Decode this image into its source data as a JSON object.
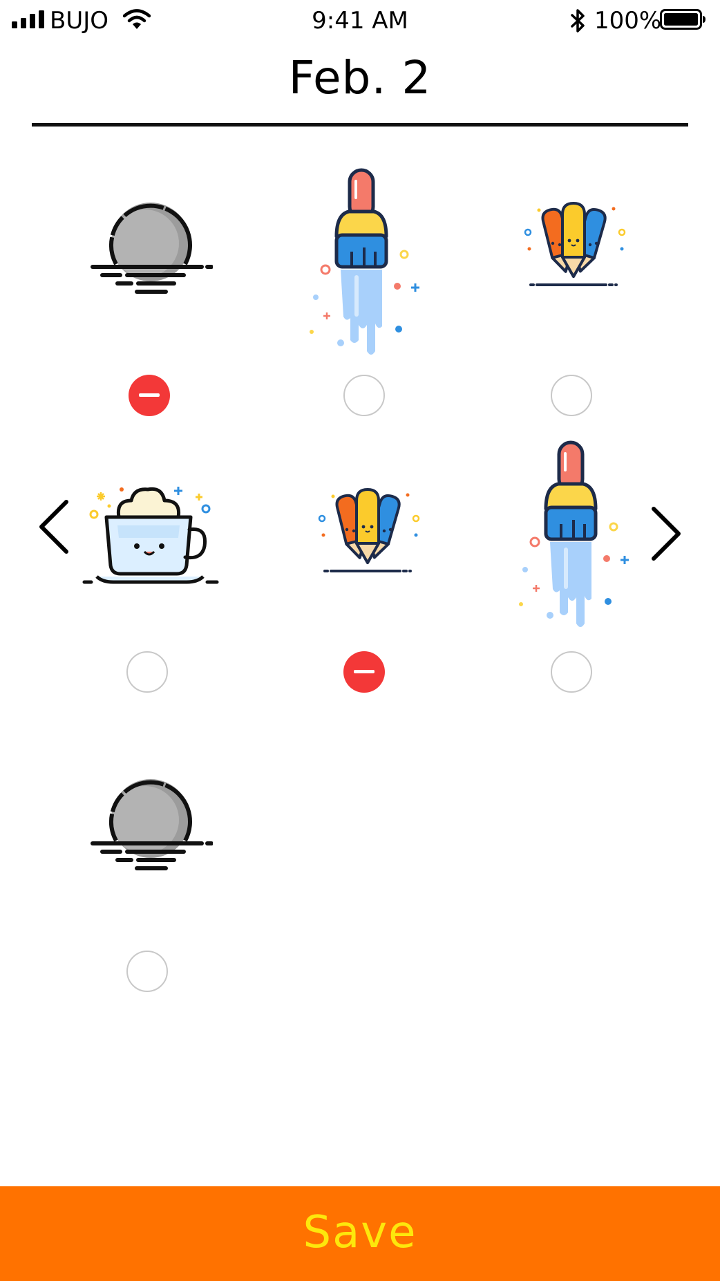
{
  "status_bar": {
    "carrier": "BUJO",
    "time": "9:41 AM",
    "battery_percent": "100%",
    "signal_icon": "cellular-signal-icon",
    "wifi_icon": "wifi-icon",
    "bluetooth_icon": "bluetooth-icon",
    "battery_icon": "battery-full-icon",
    "battery_level": 1.0
  },
  "header": {
    "title": "Feb. 2"
  },
  "stickers": [
    {
      "icon": "moon-over-water-icon",
      "selected": true
    },
    {
      "icon": "paintbrush-icon",
      "selected": false
    },
    {
      "icon": "colored-pencils-icon",
      "selected": false
    },
    {
      "icon": "coffee-cup-icon",
      "selected": false
    },
    {
      "icon": "colored-pencils-icon",
      "selected": true
    },
    {
      "icon": "paintbrush-icon",
      "selected": false
    },
    {
      "icon": "moon-over-water-icon",
      "selected": false
    }
  ],
  "navigation": {
    "previous_icon": "chevron-left-icon",
    "next_icon": "chevron-right-icon"
  },
  "footer": {
    "save_label": "Save"
  },
  "colors": {
    "accent": "#ff7200",
    "save_text": "#fde70c",
    "selected_radio": "#f33838",
    "radio_border": "#c8c8c8",
    "divider": "#111111"
  }
}
